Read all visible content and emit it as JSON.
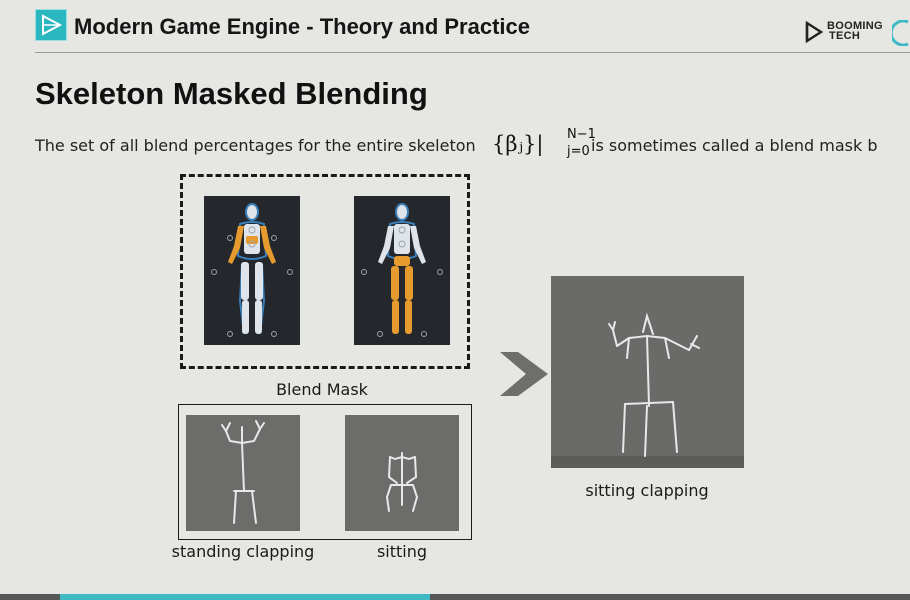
{
  "header": {
    "title": "Modern Game Engine - Theory and Practice",
    "brand": "BOOMING TECH",
    "brand_line1": "BOOMING",
    "brand_line2": "TECH"
  },
  "slide": {
    "title": "Skeleton Masked Blending",
    "description": "The set of all blend percentages for the entire skeleton",
    "formula_base": "{βⱼ}|",
    "formula_sup": "N−1",
    "formula_sub": "j=0",
    "description_tail": "is sometimes called a blend mask b"
  },
  "figures": {
    "blend_mask_label": "Blend Mask",
    "standing_label": "standing clapping",
    "sitting_label": "sitting",
    "result_label": "sitting clapping"
  },
  "colors": {
    "accent": "#2bb7c0",
    "mask_highlight": "#e79a2e",
    "skeleton_line": "#e8e8e8",
    "panel_bg": "#6c6c6a"
  }
}
